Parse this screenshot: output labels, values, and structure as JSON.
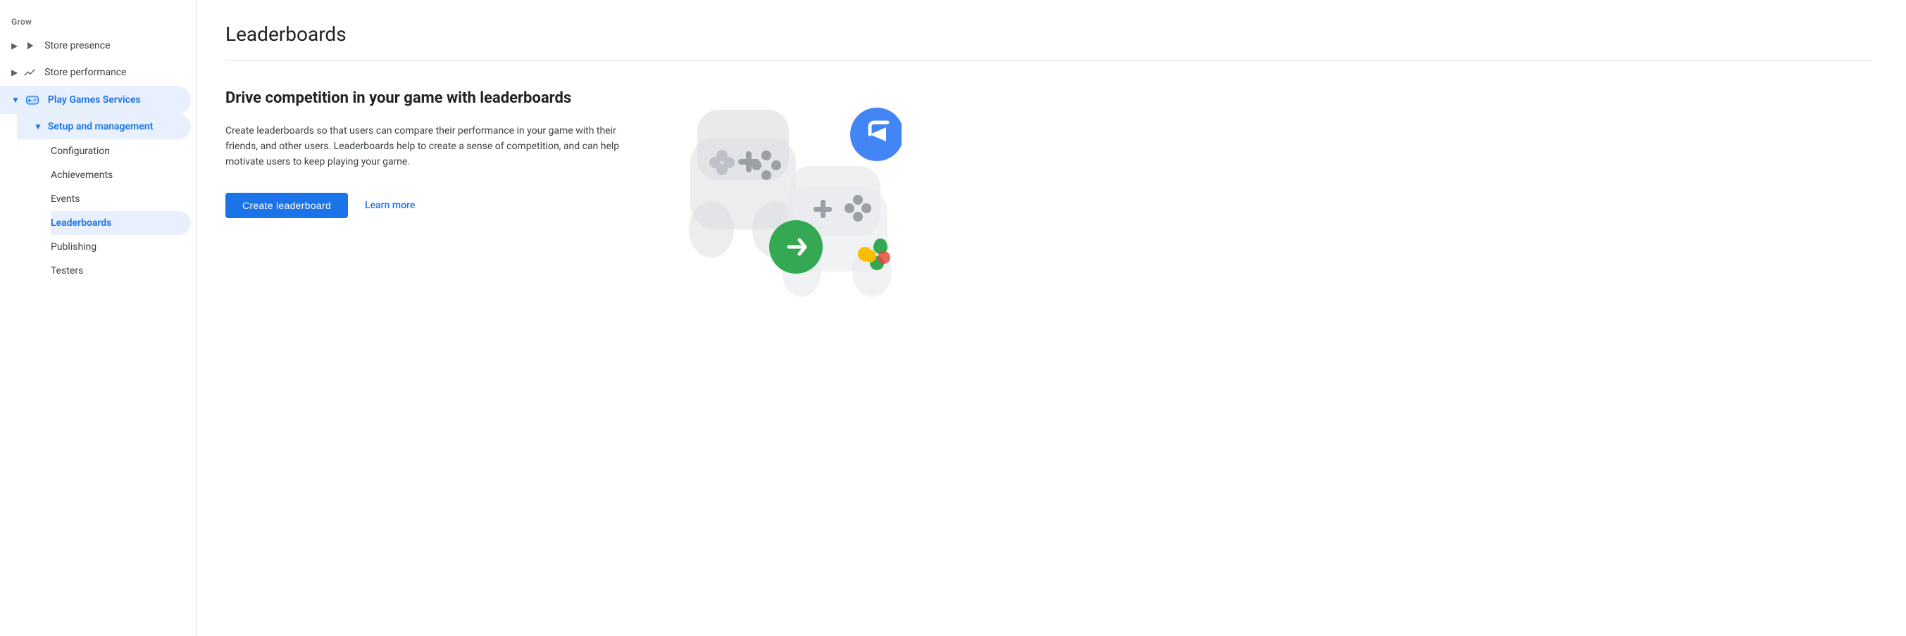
{
  "sidebar": {
    "grow_label": "Grow",
    "items": [
      {
        "id": "store-presence",
        "label": "Store presence",
        "icon": "play-icon",
        "expandable": true,
        "expanded": false,
        "active": false,
        "level": 0
      },
      {
        "id": "store-performance",
        "label": "Store performance",
        "icon": "trend-icon",
        "expandable": true,
        "expanded": false,
        "active": false,
        "level": 0
      },
      {
        "id": "play-games-services",
        "label": "Play Games Services",
        "icon": "gamepad-icon",
        "expandable": true,
        "expanded": true,
        "active": true,
        "level": 0,
        "children": [
          {
            "id": "setup-management",
            "label": "Setup and management",
            "expandable": true,
            "expanded": true,
            "active": true,
            "level": 1,
            "children": [
              {
                "id": "configuration",
                "label": "Configuration",
                "active": false,
                "level": 2
              },
              {
                "id": "achievements",
                "label": "Achievements",
                "active": false,
                "level": 2
              },
              {
                "id": "events",
                "label": "Events",
                "active": false,
                "level": 2
              },
              {
                "id": "leaderboards",
                "label": "Leaderboards",
                "active": true,
                "level": 2
              },
              {
                "id": "publishing",
                "label": "Publishing",
                "active": false,
                "level": 2
              },
              {
                "id": "testers",
                "label": "Testers",
                "active": false,
                "level": 2
              }
            ]
          }
        ]
      }
    ]
  },
  "main": {
    "page_title": "Leaderboards",
    "section_heading": "Drive competition in your game with leaderboards",
    "section_desc": "Create leaderboards so that users can compare their performance in your game with their friends, and other users. Leaderboards help to create a sense of competition, and can help motivate users to keep playing your game.",
    "create_btn_label": "Create leaderboard",
    "learn_more_label": "Learn more"
  }
}
